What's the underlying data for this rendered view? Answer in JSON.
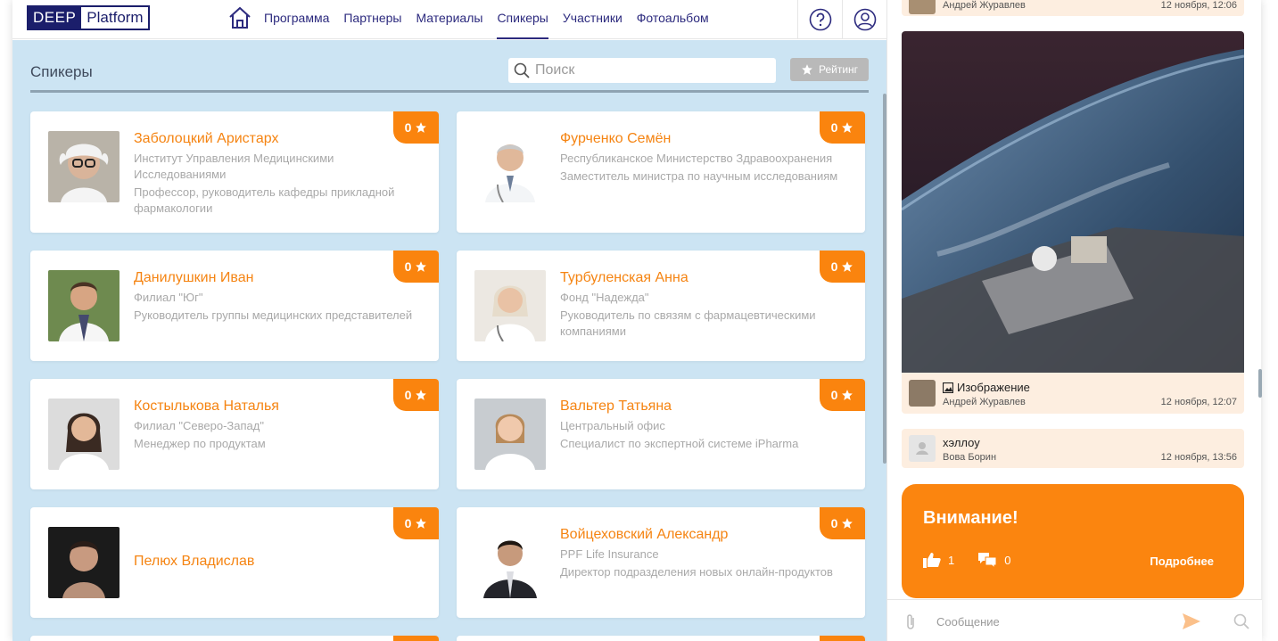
{
  "header": {
    "logo_part1": "DEEP",
    "logo_part2": "Platform",
    "nav": [
      "Программа",
      "Партнеры",
      "Материалы",
      "Спикеры",
      "Участники",
      "Фотоальбом"
    ],
    "active_nav": "Спикеры"
  },
  "page": {
    "title": "Спикеры",
    "search_placeholder": "Поиск",
    "rating_label": "Рейтинг"
  },
  "speakers": [
    {
      "name": "Заболоцкий Аристарх",
      "org": "Институт Управления Медицинскими Исследованиями",
      "position": "Профессор, руководитель кафедры прикладной фармакологии",
      "rating": "0"
    },
    {
      "name": "Фурченко Семён",
      "org": "Республиканское Министерство Здравоохранения",
      "position": "Заместитель министра по научным исследованиям",
      "rating": "0"
    },
    {
      "name": "Данилушкин Иван",
      "org": "Филиал \"Юг\"",
      "position": "Руководитель группы медицинских представителей",
      "rating": "0"
    },
    {
      "name": "Турбуленская Анна",
      "org": "Фонд \"Надежда\"",
      "position": "Руководитель по связям с фармацевтическими компаниями",
      "rating": "0"
    },
    {
      "name": "Костылькова Наталья",
      "org": "Филиал \"Северо-Запад\"",
      "position": "Менеджер по продуктам",
      "rating": "0"
    },
    {
      "name": "Вальтер Татьяна",
      "org": "Центральный офис",
      "position": "Специалист по экспертной системе iPharma",
      "rating": "0"
    },
    {
      "name": "Пелюх Владислав",
      "org": "",
      "position": "",
      "rating": "0"
    },
    {
      "name": "Войцеховский Александр",
      "org": "PPF Life Insurance",
      "position": "Директор подразделения новых онлайн-продуктов",
      "rating": "0"
    }
  ],
  "chat": {
    "top_message": {
      "author": "Андрей Журавлев",
      "time": "12 ноября, 12:06"
    },
    "image_message": {
      "text": "Изображение",
      "author": "Андрей Журавлев",
      "time": "12 ноября, 12:07"
    },
    "text_message": {
      "text": "хэллоу",
      "author": "Вова Борин",
      "time": "12 ноября, 13:56"
    },
    "alert": {
      "title": "Внимание!",
      "likes": "1",
      "comments": "0",
      "more": "Подробнее"
    },
    "input_placeholder": "Сообщение"
  },
  "colors": {
    "accent": "#fa840e",
    "nav": "#2c2a7e",
    "main_bg": "#cce4f3",
    "chat_bubble": "#fdeee0"
  }
}
